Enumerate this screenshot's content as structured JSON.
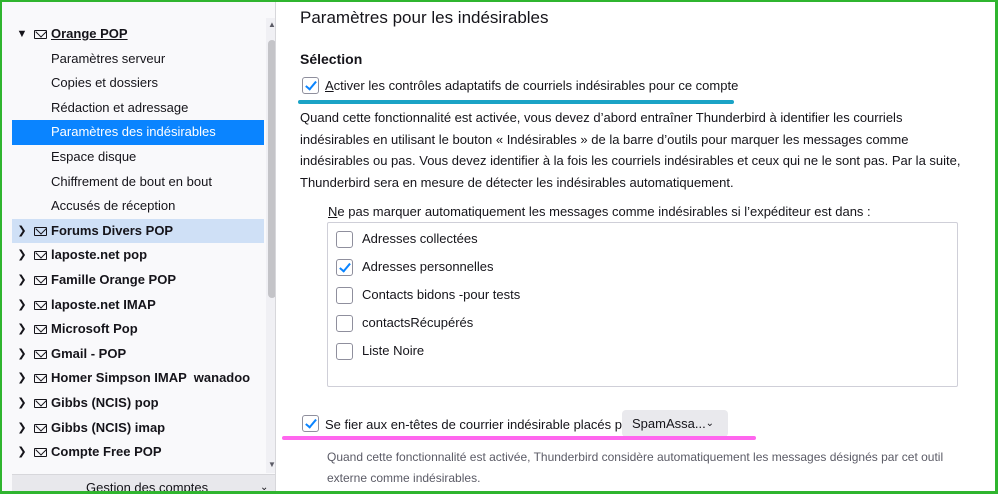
{
  "sidebar": {
    "accounts_top": {
      "twisty": "▼",
      "label": "Orange POP"
    },
    "subitems": [
      {
        "label": "Paramètres serveur"
      },
      {
        "label": "Copies et dossiers"
      },
      {
        "label": "Rédaction et adressage"
      },
      {
        "label": "Paramètres des indésirables"
      },
      {
        "label": "Espace disque"
      },
      {
        "label": "Chiffrement de bout en bout"
      },
      {
        "label": "Accusés de réception"
      }
    ],
    "accounts": [
      {
        "label": "Forums Divers POP"
      },
      {
        "label": "laposte.net pop"
      },
      {
        "label": "Famille Orange POP"
      },
      {
        "label": "laposte.net IMAP"
      },
      {
        "label": "Microsoft Pop"
      },
      {
        "label": "Gmail - POP"
      },
      {
        "label": "Homer Simpson IMAP  wanadoo"
      },
      {
        "label": "Gibbs (NCIS) pop"
      },
      {
        "label": "Gibbs (NCIS) imap"
      },
      {
        "label": "Compte Free POP"
      }
    ],
    "collapsed_twisty": "❯",
    "account_management": "Gestion des comptes",
    "account_management_chevron": "⌄"
  },
  "main": {
    "title": "Paramètres pour les indésirables",
    "section": "Sélection",
    "adaptive": {
      "label": "Activer les contrôles adaptatifs de courriels indésirables pour ce compte",
      "checked": true
    },
    "description": "Quand cette fonctionnalité est activée, vous devez d’abord entraîner Thunderbird à identifier les courriels indésirables en utilisant le bouton « Indésirables » de la barre d’outils pour marquer les messages comme indésirables ou pas. Vous devez identifier à la fois les courriels indésirables et ceux qui ne le sont pas. Par la suite, Thunderbird sera en mesure de détecter les indésirables automatiquement.",
    "whitelist_caption": "Ne pas marquer automatiquement les messages comme indésirables si l’expéditeur est dans :",
    "address_books": [
      {
        "label": "Adresses collectées",
        "checked": false
      },
      {
        "label": "Adresses personnelles",
        "checked": true
      },
      {
        "label": "Contacts bidons -pour tests",
        "checked": false
      },
      {
        "label": "contactsRécupérés",
        "checked": false
      },
      {
        "label": "Liste Noire",
        "checked": false
      }
    ],
    "trust_headers": {
      "label": "Se fier aux en-têtes de courrier indésirable placés par :",
      "checked": true,
      "selected": "SpamAssa...",
      "chevron": "⌄"
    },
    "trust_note": "Quand cette fonctionnalité est activée, Thunderbird considère automatiquement les messages désignés par cet outil externe comme indésirables."
  },
  "colors": {
    "selection": "#0a84ff",
    "hover_row": "#cfe0f6",
    "annotation_blue": "#1aa3c6",
    "annotation_pink": "#ff66ee",
    "frame": "#2fb52f"
  }
}
